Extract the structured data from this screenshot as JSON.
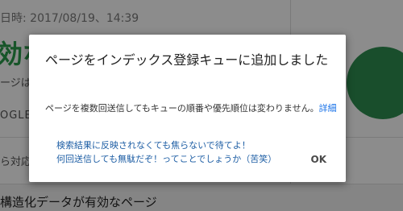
{
  "background": {
    "timestamp": "日時: 2017/08/19、14:39",
    "big_status": "効なペ",
    "sub_text": "ージは",
    "google_label": "OGLE",
    "section_text": "ら対応",
    "footer_text": "構造化データが有効なページ"
  },
  "dialog": {
    "title": "ページをインデックス登録キューに追加しました",
    "body": "ページを複数回送信してもキューの順番や優先順位は変わりません。",
    "details_link": "詳細",
    "note_line1": "検索結果に反映されなくても焦らないで待てよ！",
    "note_line2": "何回送信しても無駄だぞ！ってことでしょうか（苦笑）",
    "ok_label": "OK"
  },
  "colors": {
    "scrim": "rgba(0,0,0,0.45)",
    "link": "#1a73e8",
    "note": "#1f5fa5",
    "status_green": "#2b9b4b"
  }
}
